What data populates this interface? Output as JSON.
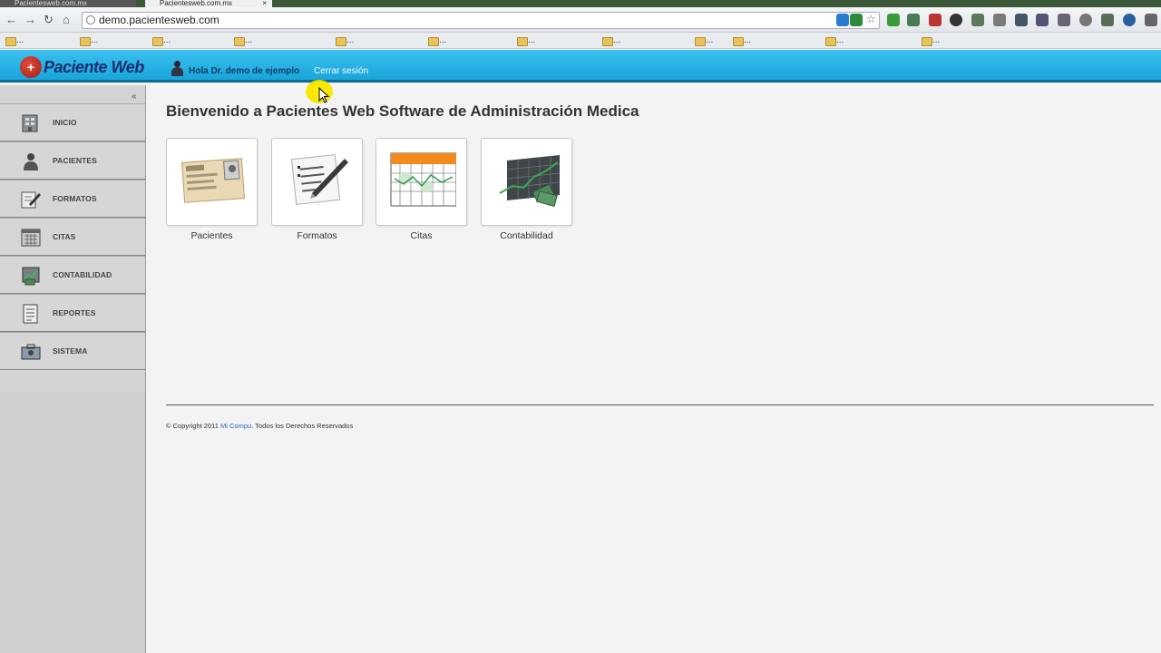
{
  "browser": {
    "tabs": [
      {
        "label": "Pacientesweb.com.mx"
      },
      {
        "label": "Pacientesweb.com.mx"
      }
    ],
    "url": "demo.pacientesweb.com",
    "bookmarks": [
      "...",
      "...",
      "...",
      "...",
      "...",
      "...",
      "...",
      "...",
      "...",
      "...",
      "...",
      "..."
    ]
  },
  "header": {
    "logo_text": "Paciente Web",
    "user_label": "Hola Dr. demo de ejemplo",
    "logout_label": "Cerrar sesión",
    "colors": {
      "bar": "#22addf",
      "logo": "#1a2e6e"
    }
  },
  "sidebar": {
    "collapse_glyph": "«",
    "items": [
      {
        "label": "INICIO",
        "icon": "home-icon"
      },
      {
        "label": "PACIENTES",
        "icon": "patient-icon"
      },
      {
        "label": "FORMATOS",
        "icon": "forms-icon"
      },
      {
        "label": "CITAS",
        "icon": "calendar-icon"
      },
      {
        "label": "CONTABILIDAD",
        "icon": "accounting-icon"
      },
      {
        "label": "REPORTES",
        "icon": "reports-icon"
      },
      {
        "label": "SISTEMA",
        "icon": "system-icon"
      }
    ]
  },
  "main": {
    "title": "Bienvenido a Pacientes Web Software de Administración Medica",
    "tiles": [
      {
        "label": "Pacientes",
        "icon": "patient-card-icon"
      },
      {
        "label": "Formatos",
        "icon": "form-pen-icon"
      },
      {
        "label": "Citas",
        "icon": "calendar-grid-icon"
      },
      {
        "label": "Contabilidad",
        "icon": "chart-money-icon"
      }
    ]
  },
  "footer": {
    "prefix": "© Copyright 2011",
    "link": "Mi Compu",
    "suffix": ". Todos los Derechos Reservados"
  }
}
